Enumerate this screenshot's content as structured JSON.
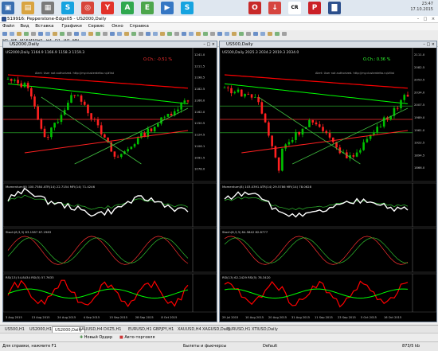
{
  "taskbar": {
    "icons": [
      {
        "name": "windows-start-icon",
        "glyph": "▣",
        "color": "#3a6fb0"
      },
      {
        "name": "folder-icon",
        "glyph": "▤",
        "color": "#d9a441"
      },
      {
        "name": "calculator-icon",
        "glyph": "▦",
        "color": "#7a7a7a"
      },
      {
        "name": "skype-icon",
        "glyph": "S",
        "color": "#16a3e0"
      },
      {
        "name": "chrome-icon",
        "glyph": "◎",
        "color": "#d8453a"
      },
      {
        "name": "yandex-icon",
        "glyph": "Y",
        "color": "#e2322a"
      },
      {
        "name": "green-a-icon",
        "glyph": "A",
        "color": "#2fa84f"
      },
      {
        "name": "evernote-icon",
        "glyph": "E",
        "color": "#4ca64c"
      },
      {
        "name": "blue-app-icon",
        "glyph": "▶",
        "color": "#3577c4"
      },
      {
        "name": "skype-icon-2",
        "glyph": "S",
        "color": "#16a3e0"
      },
      {
        "name": "opera-icon",
        "glyph": "O",
        "color": "#c82a2a"
      },
      {
        "name": "download-icon",
        "glyph": "↓",
        "color": "#d64540"
      },
      {
        "name": "cr-icon",
        "glyph": "CR",
        "color": "#ffffff"
      },
      {
        "name": "pinterest-icon",
        "glyph": "P",
        "color": "#cb2027"
      },
      {
        "name": "terminal-icon",
        "glyph": "▇",
        "color": "#2c4f8c"
      }
    ],
    "clock_time": "23:47",
    "clock_date": "17.10.2015"
  },
  "window": {
    "title": "519916: Pepperstone-Edge05 - US2000,Daily"
  },
  "menu": [
    "Файл",
    "Вид",
    "Вставка",
    "Графики",
    "Сервис",
    "Окно",
    "Справка"
  ],
  "timeframes": [
    "M1",
    "M5",
    "M15",
    "M30",
    "H1",
    "H4",
    "D1",
    "W1",
    "MN"
  ],
  "charts": [
    {
      "caption": "US2000,Daily",
      "info": "US2000,Daily  1164.9 1166.9 1158.3 1159.3",
      "annotation": "O.Ch.: -0.51 %",
      "alert": "Alert: User not authorized. http://my.clusterdelta.ru/#list",
      "price_labels": [
        "1241.0",
        "1211.5",
        "1198.5",
        "1182.5",
        "1166.0",
        "1162.0",
        "1150.5",
        "1124.5",
        "1106.1",
        "1091.5",
        "1078.0"
      ],
      "momentum_label": "Momentum(8) 100.7584  ATR(14) 22.7154  MFI(14) 71.4246",
      "stoch_label": "Stoch(8,3,3) 63.1587 67.2983",
      "rsi_label": "RSI(13) 54.8434  RSI(5) 57.7633",
      "date_labels": [
        "3 Aug 2015",
        "13 Aug 2015",
        "24 Aug 2015",
        "4 Sep 2015",
        "15 Sep 2015",
        "28 Sep 2015",
        "8 Oct 2015"
      ]
    },
    {
      "caption": "US500,Daily",
      "info": "US500,Daily  2025.3 2034.2 2019.3 2034.0",
      "annotation": "O.Ch.: 0.36 %",
      "alert": "Alert: User not authorized. http://my.clusterdelta.ru/#list",
      "price_labels": [
        "2111.0",
        "2082.5",
        "2053.5",
        "2034.0",
        "2007.5",
        "1989.0",
        "1961.0",
        "1922.5",
        "1894.5",
        "1866.0"
      ],
      "momentum_label": "Momentum(8) 103.0391  ATR(14) 29.5786  MFI(14) 78.0628",
      "stoch_label": "Stoch(8,3,3) 84.5842 82.8777",
      "rsi_label": "RSI(13) 62.2429  RSI(5) 78.3420",
      "date_labels": [
        "29 Jul 2015",
        "10 Aug 2015",
        "20 Aug 2015",
        "31 Aug 2015",
        "11 Sep 2015",
        "23 Sep 2015",
        "5 Oct 2015",
        "16 Oct 2015"
      ]
    }
  ],
  "tabs": [
    "US500,H1",
    "US2000,H1",
    "US2000,Daily",
    "XAUUSD,H4",
    "DXZ5,H1",
    "EURUSD,H1",
    "GBPJPY,H1",
    "XAUUSD,H4",
    "XAGUSD,Daily",
    "EURUSD,H1",
    "XTIUSD,Daily"
  ],
  "active_tab": "US2000,Daily",
  "bottom_toolbar": {
    "new_order": "Новый Ордер",
    "autotrading": "Авто-торговля"
  },
  "status": {
    "help": "Для справки, нажмите F1",
    "profile": "Default",
    "bars": "Былеты и фьючерсы",
    "traffic": "873/5 kb"
  },
  "colors": {
    "price_green": "#00c000",
    "price_red": "#ff2020",
    "ma_red": "#ff0000",
    "ma_green": "#00ff00",
    "momentum": "#ffffff",
    "rsi_red": "#ff0000",
    "rsi_green": "#00ff00"
  }
}
